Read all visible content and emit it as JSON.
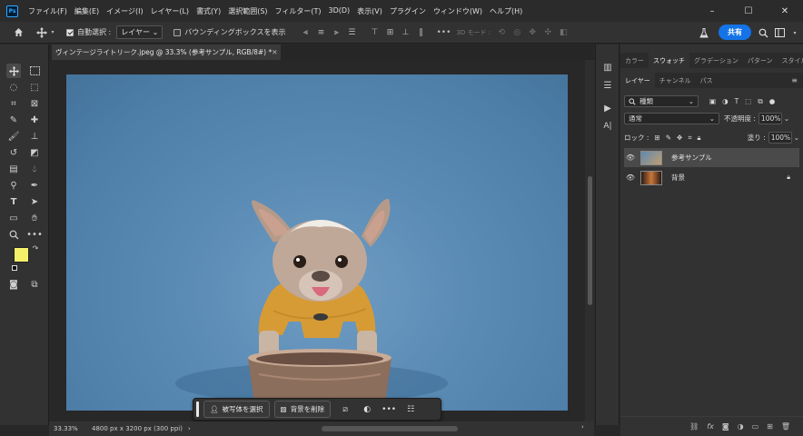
{
  "menu": {
    "logo": "Ps",
    "items": [
      "ファイル(F)",
      "編集(E)",
      "イメージ(I)",
      "レイヤー(L)",
      "書式(Y)",
      "選択範囲(S)",
      "フィルター(T)",
      "3D(D)",
      "表示(V)",
      "プラグイン",
      "ウィンドウ(W)",
      "ヘルプ(H)"
    ],
    "window_buttons": [
      "–",
      "☐",
      "✕"
    ]
  },
  "options": {
    "auto_select_label": "自動選択 :",
    "auto_select_checked": true,
    "auto_select_target": "レイヤー",
    "bbox_label": "バウンディングボックスを表示",
    "bbox_checked": false,
    "mode_3d": "3D モード :",
    "share_label": "共有"
  },
  "document": {
    "tab_title": "ヴィンテージライトリーク.jpeg @ 33.3% (参考サンプル, RGB/8#) *",
    "zoom": "33.33%",
    "dimensions": "4800 px x 3200 px (300 ppi)"
  },
  "taskbar": {
    "select_subject": "被写体を選択",
    "remove_bg": "背景を削除"
  },
  "panels": {
    "top_tabs": [
      "カラー",
      "スウォッチ",
      "グラデーション",
      "パターン",
      "スタイル"
    ],
    "top_active": 1,
    "layer_tabs": [
      "レイヤー",
      "チャンネル",
      "パス"
    ],
    "layer_active": 0,
    "filter_kind": "種類",
    "blend_mode": "通常",
    "opacity_label": "不透明度 :",
    "opacity_value": "100%",
    "lock_label": "ロック :",
    "fill_label": "塗り :",
    "fill_value": "100%",
    "layers": [
      {
        "name": "参考サンプル",
        "selected": true,
        "locked": false
      },
      {
        "name": "背景",
        "selected": false,
        "locked": true
      }
    ]
  },
  "colors": {
    "foreground": "#f5f06a",
    "background": "#ffffff",
    "accent": "#1473e6"
  }
}
